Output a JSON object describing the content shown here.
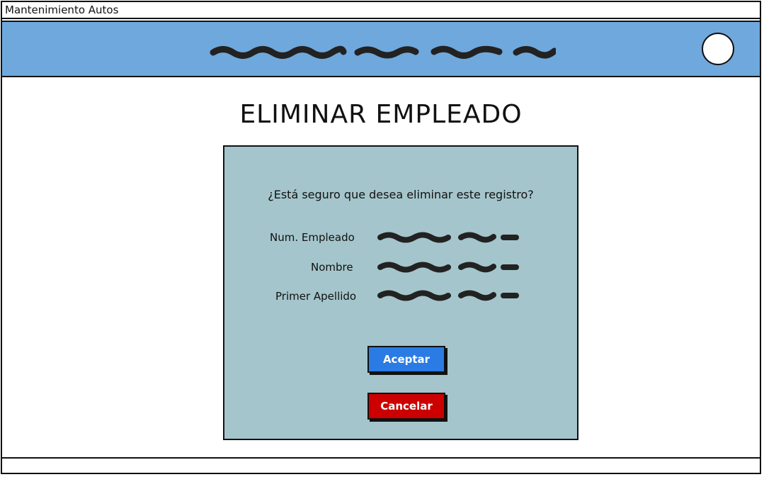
{
  "window": {
    "title": "Mantenimiento Autos"
  },
  "page": {
    "title": "ELIMINAR EMPLEADO"
  },
  "dialog": {
    "question": "¿Está seguro que desea eliminar este registro?",
    "fields": [
      {
        "label": "Num. Empleado"
      },
      {
        "label": "Nombre"
      },
      {
        "label": "Primer Apellido"
      }
    ],
    "accept_label": "Aceptar",
    "cancel_label": "Cancelar"
  },
  "colors": {
    "header_bg": "#6fa8dc",
    "panel_bg": "#a4c5cb",
    "accept_bg": "#2a7be4",
    "cancel_bg": "#cc0000"
  }
}
